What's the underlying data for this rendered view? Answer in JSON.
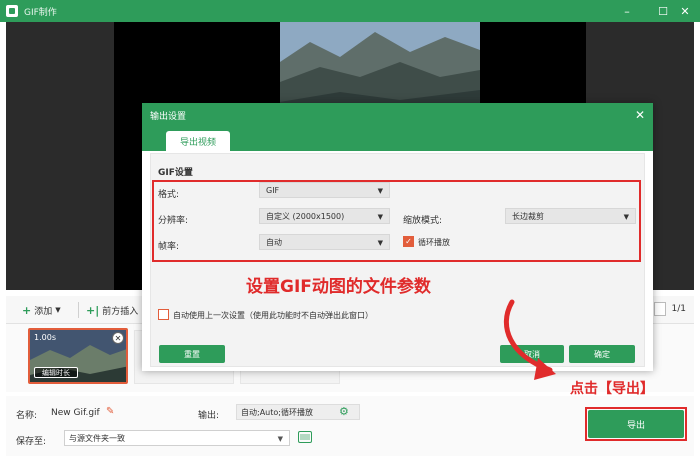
{
  "window": {
    "title": "GIF制作",
    "controls": {
      "minimize": "–",
      "maximize": "☐",
      "close": "✕"
    }
  },
  "toolbar": {
    "add_label": "添加",
    "insert_before_label": "前方插入",
    "page_indicator": "1/1"
  },
  "filmstrip": {
    "frame_duration": "1.00s",
    "edit_duration_label": "编辑时长"
  },
  "bottom": {
    "name_label": "名称:",
    "name_value": "New Gif.gif",
    "output_label": "输出:",
    "output_value": "自动;Auto;循环播放",
    "save_label": "保存至:",
    "save_value": "与源文件夹一致",
    "export_label": "导出"
  },
  "dialog": {
    "title": "输出设置",
    "tab_label": "导出视频",
    "section_title": "GIF设置",
    "format_label": "格式:",
    "format_value": "GIF",
    "resolution_label": "分辨率:",
    "resolution_value": "自定义 (2000x1500)",
    "scale_mode_label": "缩放模式:",
    "scale_mode_value": "长边裁剪",
    "framerate_label": "帧率:",
    "framerate_value": "自动",
    "loop_label": "循环播放",
    "loop_checked": true,
    "use_last_label": "自动使用上一次设置（使用此功能时不自动弹出此窗口）",
    "use_last_checked": false,
    "reset_label": "重置",
    "cancel_label": "取消",
    "ok_label": "确定"
  },
  "annotations": {
    "main": "设置GIF动图的文件参数",
    "export_hint": "点击【导出】"
  },
  "colors": {
    "brand_green": "#2e9c5a",
    "annotation_red": "#e02b2b",
    "checkbox_orange": "#e25d3b"
  },
  "icons": [
    "app-icon",
    "plus-icon",
    "dropdown-arrow-icon",
    "close-icon",
    "pencil-icon",
    "gear-icon",
    "folder-icon",
    "check-icon",
    "curved-arrow-icon"
  ]
}
